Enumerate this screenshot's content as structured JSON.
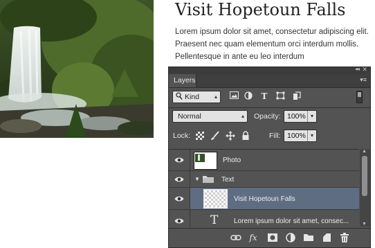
{
  "article": {
    "title": "Visit Hopetoun Falls",
    "body": "Lorem ipsum dolor sit amet, consectetur adipiscing elit. Praesent nec quam elementum orci interdum mollis. Pellentesque in ante eu leo interdum"
  },
  "panel": {
    "tab_label": "Layers",
    "collapse_glyph": "◂◂",
    "close_glyph": "✕",
    "menu_glyph": "▾≡",
    "filter": {
      "selected": "Kind",
      "icons": [
        "image-filter-icon",
        "adjustment-filter-icon",
        "type-filter-icon",
        "shape-filter-icon",
        "smart-object-filter-icon"
      ]
    },
    "blend_mode": "Normal",
    "opacity_label": "Opacity:",
    "opacity_value": "100%",
    "lock_label": "Lock:",
    "fill_label": "Fill:",
    "fill_value": "100%",
    "layers": [
      {
        "name": "Photo",
        "type": "image",
        "visible": true,
        "selected": false
      },
      {
        "name": "Text",
        "type": "group",
        "visible": true,
        "selected": false,
        "expanded": true
      },
      {
        "name": "Visit Hopetoun Falls",
        "type": "smart-object",
        "visible": true,
        "selected": true
      },
      {
        "name": "Lorem ipsum dolor sit amet, consec...",
        "type": "text",
        "visible": true,
        "selected": false
      }
    ],
    "type_glyph": "T",
    "bottom_icons": [
      "link-layers-icon",
      "fx-icon",
      "add-mask-icon",
      "adjustment-layer-icon",
      "new-group-icon",
      "new-layer-icon",
      "trash-icon"
    ],
    "fx_label": "fx"
  }
}
